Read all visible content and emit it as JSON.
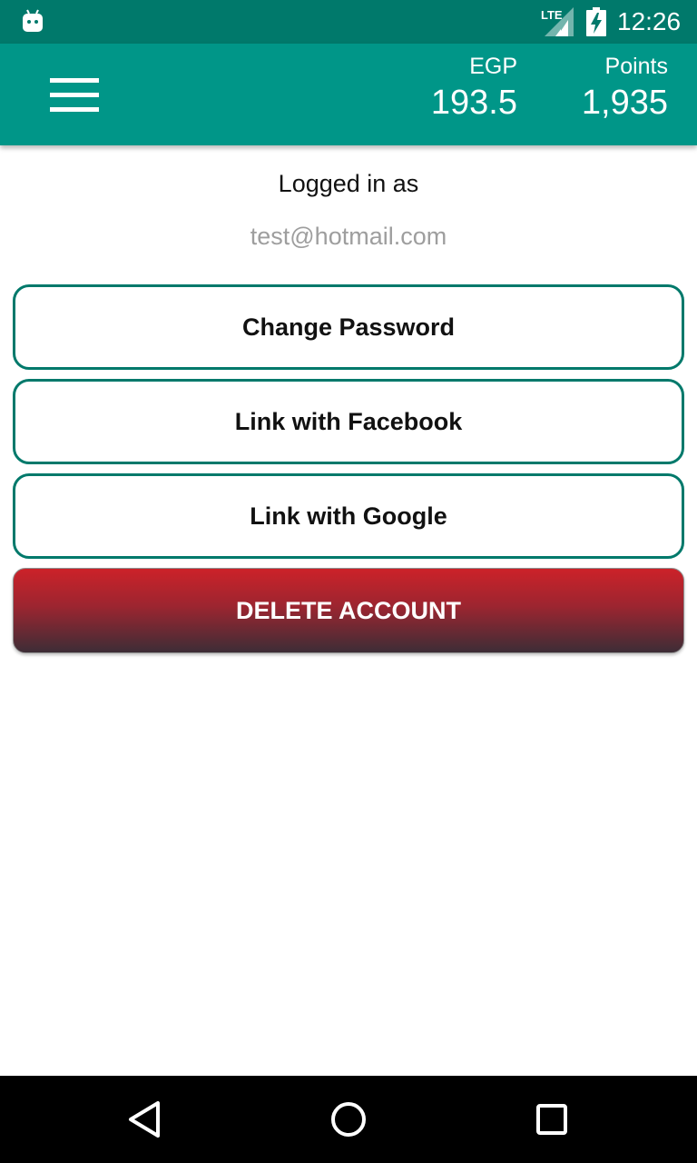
{
  "status_bar": {
    "time": "12:26",
    "network_label": "LTE",
    "icons": [
      "android-debug-icon",
      "lte-signal-icon",
      "battery-charging-icon"
    ]
  },
  "app_bar": {
    "menu_icon": "hamburger-menu-icon",
    "egp": {
      "label": "EGP",
      "value": "193.5"
    },
    "points": {
      "label": "Points",
      "value": "1,935"
    },
    "color": "#009688"
  },
  "account": {
    "logged_in_label": "Logged in as",
    "email": "test@hotmail.com"
  },
  "actions": {
    "change_password": "Change Password",
    "link_facebook": "Link with Facebook",
    "link_google": "Link with Google",
    "delete_account": "DELETE ACCOUNT"
  },
  "nav_bar": {
    "icons": [
      "back-icon",
      "home-icon",
      "recent-apps-icon"
    ]
  },
  "colors": {
    "status_bar": "#00796b",
    "app_bar": "#009688",
    "button_border": "#00796b",
    "delete_top": "#cc2229",
    "delete_bottom": "#3d2d36"
  }
}
